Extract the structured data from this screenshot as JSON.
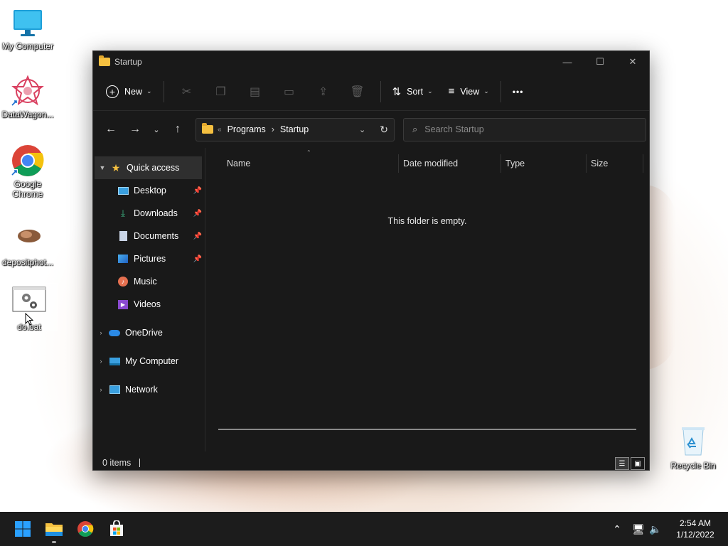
{
  "desktop": {
    "icons": [
      {
        "label": "My Computer"
      },
      {
        "label": "DataWagon..."
      },
      {
        "label": "Google Chrome"
      },
      {
        "label": "depositphot..."
      },
      {
        "label": "do.bat"
      },
      {
        "label": "Recycle Bin"
      }
    ]
  },
  "window": {
    "title": "Startup",
    "controls": {
      "minimize": "—",
      "maximize": "☐",
      "close": "✕"
    }
  },
  "toolbar": {
    "new_label": "New",
    "sort_label": "Sort",
    "view_label": "View",
    "more_label": "•••"
  },
  "address": {
    "overflow": "«",
    "crumbs": [
      "Programs",
      "Startup"
    ],
    "separator": "›"
  },
  "search": {
    "placeholder": "Search Startup"
  },
  "nav": {
    "quick_access": "Quick access",
    "items": [
      {
        "label": "Desktop"
      },
      {
        "label": "Downloads"
      },
      {
        "label": "Documents"
      },
      {
        "label": "Pictures"
      },
      {
        "label": "Music"
      },
      {
        "label": "Videos"
      }
    ],
    "onedrive": "OneDrive",
    "my_computer": "My Computer",
    "network": "Network"
  },
  "columns": {
    "name": "Name",
    "date": "Date modified",
    "type": "Type",
    "size": "Size"
  },
  "empty_text": "This folder is empty.",
  "status": {
    "items": "0 items"
  },
  "taskbar": {
    "time": "2:54 AM",
    "date": "1/12/2022"
  },
  "colors": {
    "accent": "#0078d4",
    "folder": "#f5c040",
    "window_bg": "#191919"
  }
}
